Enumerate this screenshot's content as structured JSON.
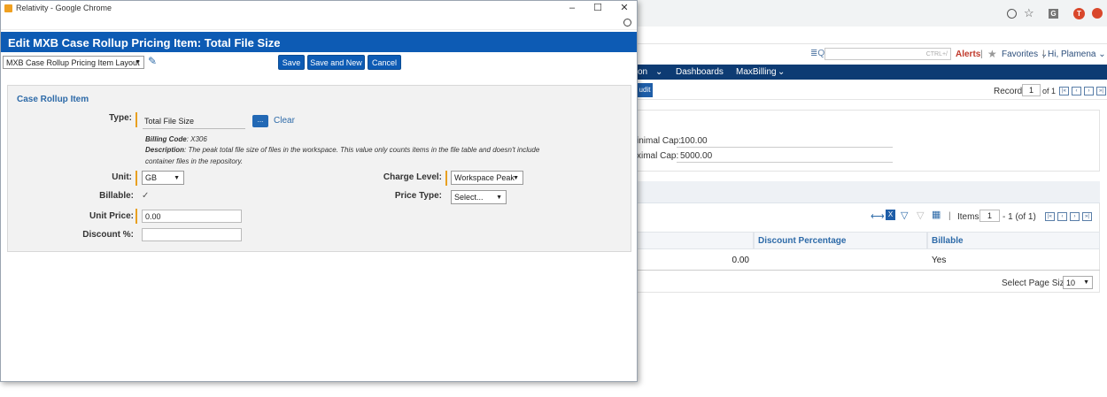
{
  "background": {
    "search_hint": "CTRL+/",
    "alerts": "Alerts",
    "favorites": "Favorites",
    "greeting": "Hi, Plamena",
    "nav": {
      "item_partial": "on",
      "dashboards": "Dashboards",
      "maxbilling": "MaxBilling"
    },
    "audit_label": "udit",
    "record": {
      "label": "Record",
      "value": "1",
      "of": "of 1"
    },
    "caps": {
      "minimal_label": "inimal Cap:",
      "minimal_value": "100.00",
      "maximal_label": "ximal Cap:",
      "maximal_value": "5000.00"
    },
    "grid": {
      "items_label": "Items",
      "items_value": "1",
      "items_of": "- 1 (of 1)",
      "columns": [
        "Discount Percentage",
        "Billable"
      ],
      "row": {
        "amount": "0.00",
        "billable": "Yes"
      },
      "page_size_label": "Select Page Size:",
      "page_size_value": "10"
    }
  },
  "popup": {
    "window_title": "Relativity - Google Chrome",
    "header": "Edit MXB Case Rollup Pricing Item: Total File Size",
    "layout_select": "MXB Case Rollup Pricing Item Layout",
    "buttons": {
      "save": "Save",
      "save_new": "Save and New",
      "cancel": "Cancel"
    },
    "section_title": "Case Rollup Item",
    "type": {
      "label": "Type:",
      "value": "Total File Size",
      "picker": "...",
      "clear": "Clear",
      "billing_code_label": "Billing Code",
      "billing_code": ": X306",
      "description_label": "Description",
      "description": ": The peak total file size of files in the workspace. This value only counts items in the file table and doesn't include container files in the repository."
    },
    "unit": {
      "label": "Unit:",
      "value": "GB"
    },
    "billable": {
      "label": "Billable:",
      "checked": true
    },
    "unit_price": {
      "label": "Unit Price:",
      "value": "0.00"
    },
    "discount": {
      "label": "Discount %:",
      "value": ""
    },
    "charge_level": {
      "label": "Charge Level:",
      "value": "Workspace Peak"
    },
    "price_type": {
      "label": "Price Type:",
      "value": "Select..."
    }
  }
}
